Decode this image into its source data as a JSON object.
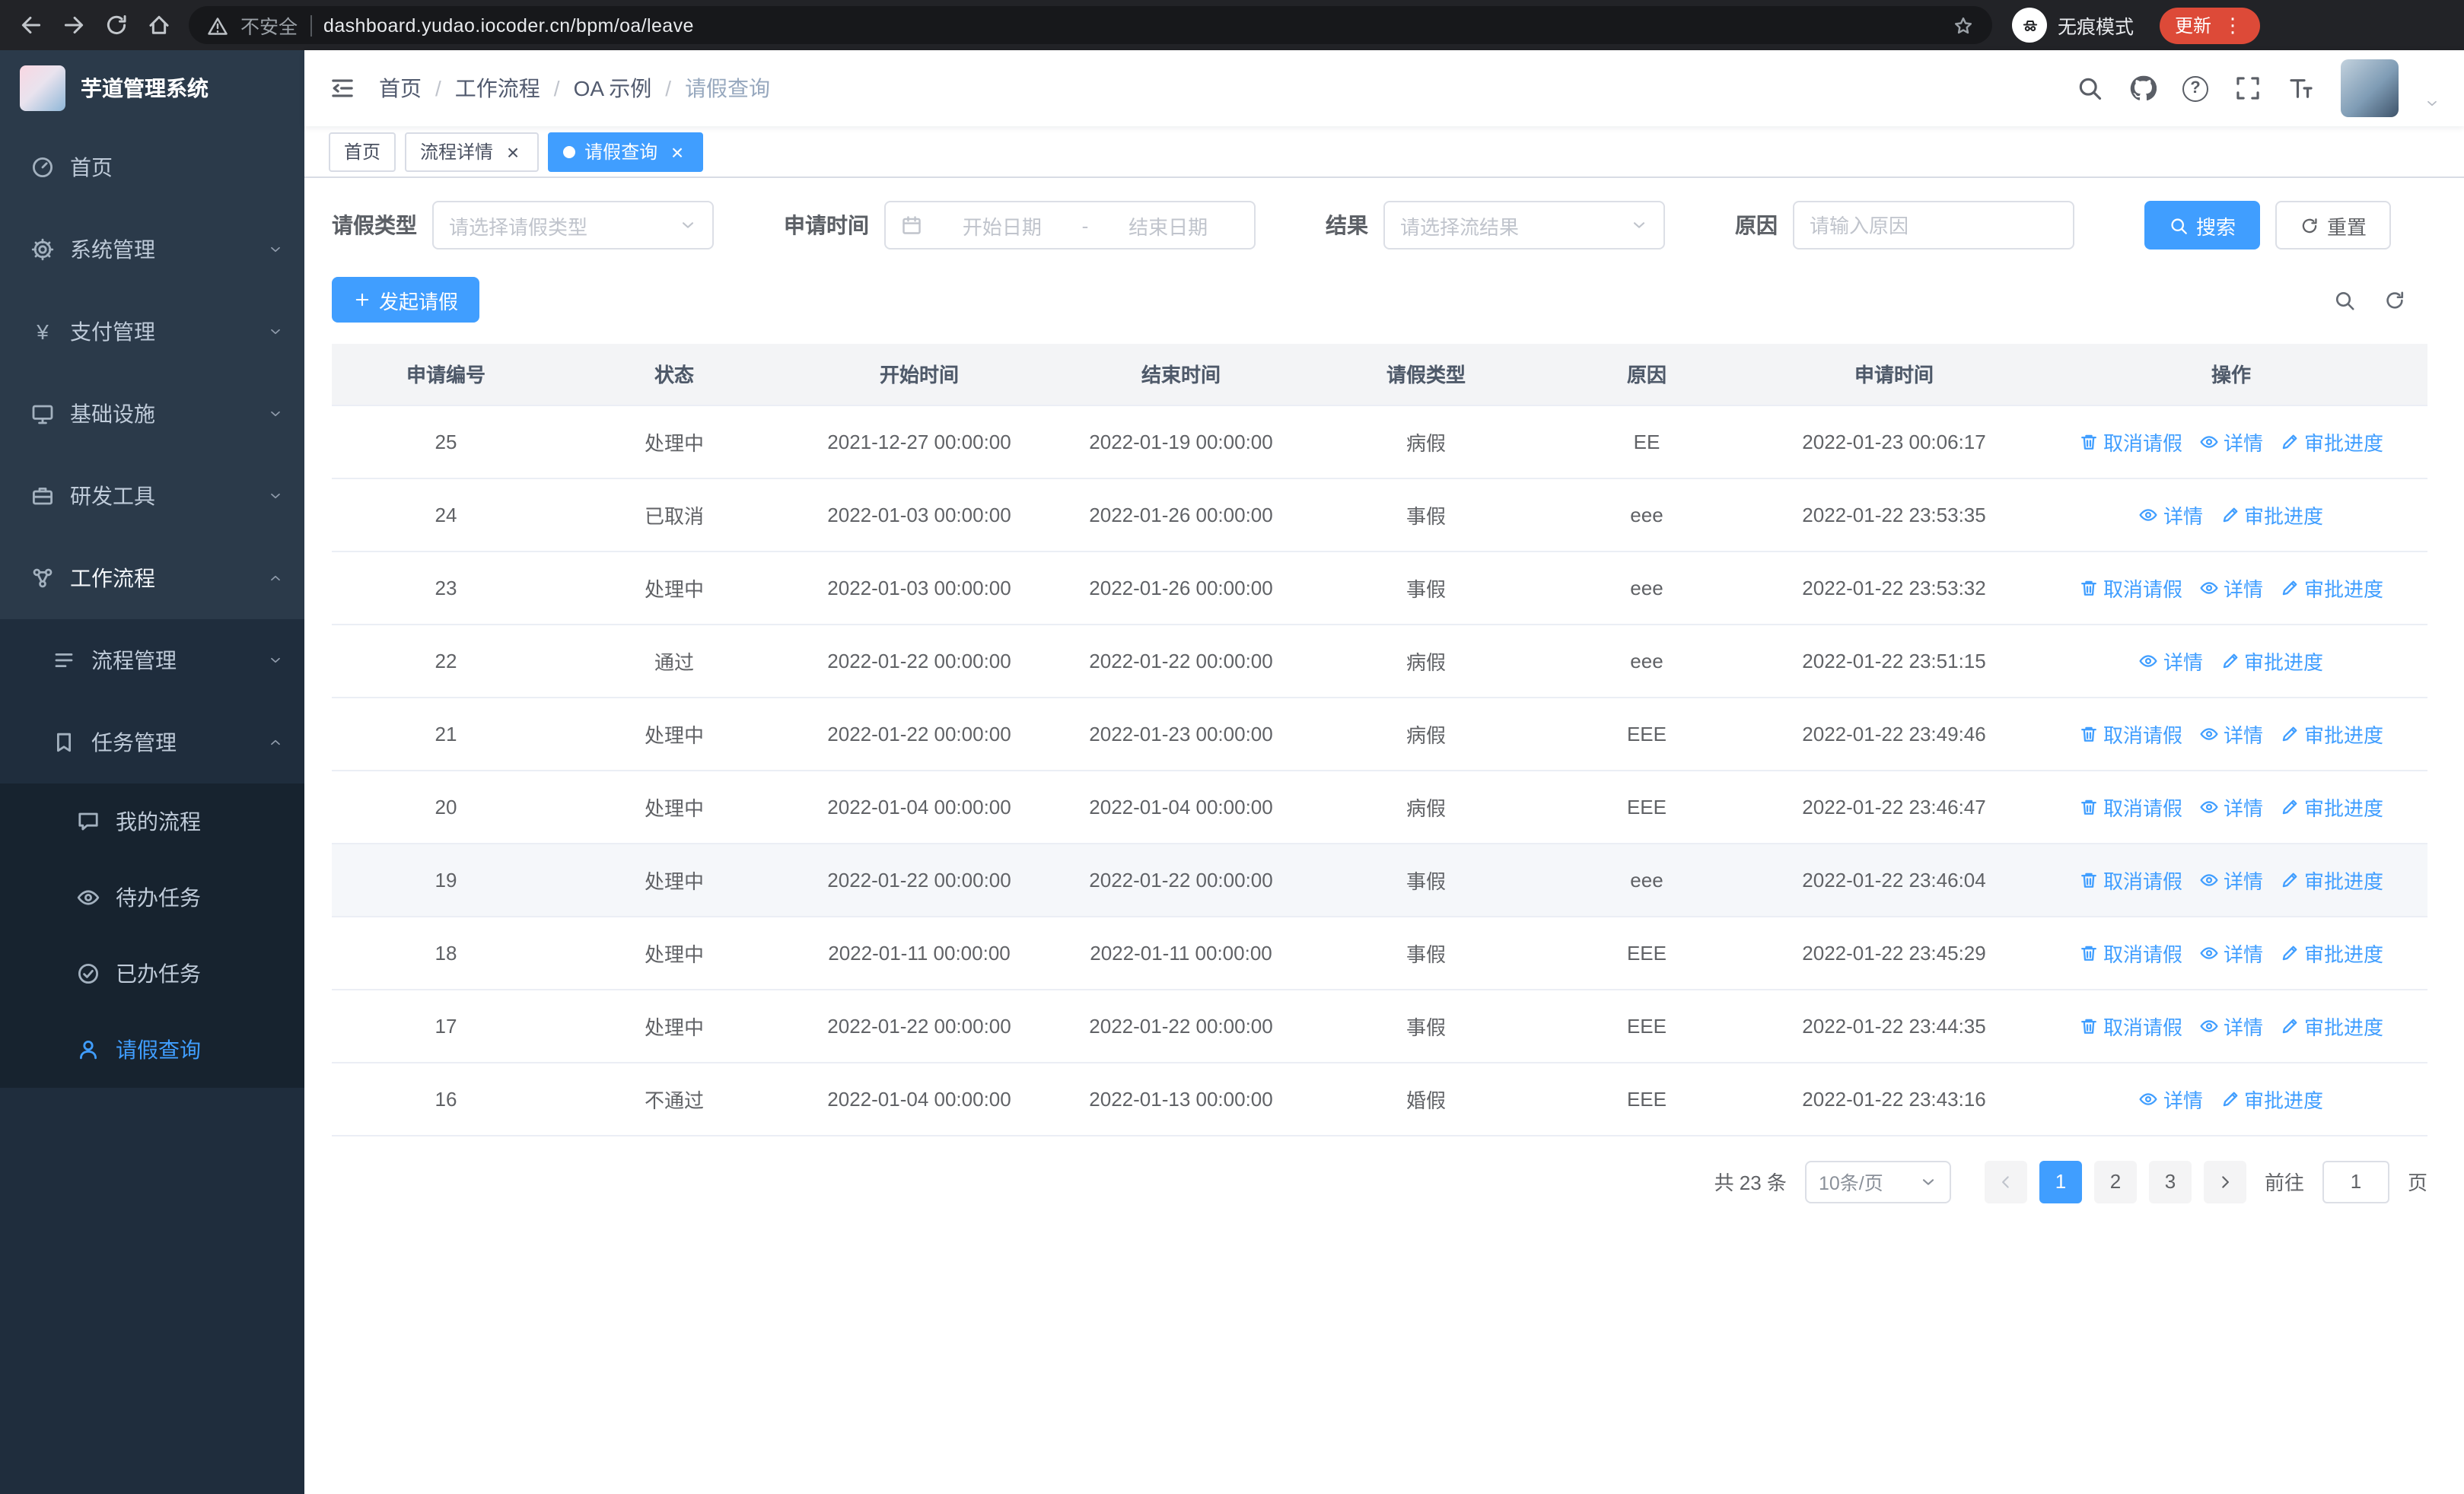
{
  "browser": {
    "security_warning": "不安全",
    "url": "dashboard.yudao.iocoder.cn/bpm/oa/leave",
    "incognito_label": "无痕模式",
    "update_label": "更新"
  },
  "sidebar": {
    "title": "芋道管理系统",
    "menu": [
      {
        "label": "首页",
        "icon": "dashboard-icon"
      },
      {
        "label": "系统管理",
        "icon": "gear-icon"
      },
      {
        "label": "支付管理",
        "icon": "yen-icon"
      },
      {
        "label": "基础设施",
        "icon": "monitor-icon"
      },
      {
        "label": "研发工具",
        "icon": "toolbox-icon"
      },
      {
        "label": "工作流程",
        "icon": "workflow-icon",
        "expanded": true,
        "children": [
          {
            "label": "流程管理",
            "icon": "process-icon"
          },
          {
            "label": "任务管理",
            "icon": "task-icon",
            "expanded": true,
            "children": [
              {
                "label": "我的流程",
                "icon": "chat-icon"
              },
              {
                "label": "待办任务",
                "icon": "eye-icon"
              },
              {
                "label": "已办任务",
                "icon": "done-icon"
              },
              {
                "label": "请假查询",
                "icon": "user-icon",
                "active": true
              }
            ]
          }
        ]
      }
    ]
  },
  "header": {
    "breadcrumb": [
      "首页",
      "工作流程",
      "OA 示例",
      "请假查询"
    ],
    "breadcrumb_separator": "/"
  },
  "tabs": [
    {
      "label": "首页",
      "closable": false,
      "active": false
    },
    {
      "label": "流程详情",
      "closable": true,
      "active": false
    },
    {
      "label": "请假查询",
      "closable": true,
      "active": true
    }
  ],
  "filters": {
    "leave_type_label": "请假类型",
    "leave_type_placeholder": "请选择请假类型",
    "apply_time_label": "申请时间",
    "start_placeholder": "开始日期",
    "range_separator": "-",
    "end_placeholder": "结束日期",
    "result_label": "结果",
    "result_placeholder": "请选择流结果",
    "reason_label": "原因",
    "reason_placeholder": "请输入原因",
    "search_label": "搜索",
    "reset_label": "重置"
  },
  "toolbar": {
    "create_label": "发起请假"
  },
  "actions": {
    "cancel": "取消请假",
    "detail": "详情",
    "progress": "审批进度"
  },
  "table": {
    "columns": [
      "申请编号",
      "状态",
      "开始时间",
      "结束时间",
      "请假类型",
      "原因",
      "申请时间",
      "操作"
    ],
    "rows": [
      {
        "id": "25",
        "status": "处理中",
        "start": "2021-12-27 00:00:00",
        "end": "2022-01-19 00:00:00",
        "type": "病假",
        "reason": "EE",
        "applied": "2022-01-23 00:06:17",
        "actions": [
          "cancel",
          "detail",
          "progress"
        ]
      },
      {
        "id": "24",
        "status": "已取消",
        "start": "2022-01-03 00:00:00",
        "end": "2022-01-26 00:00:00",
        "type": "事假",
        "reason": "eee",
        "applied": "2022-01-22 23:53:35",
        "actions": [
          "detail",
          "progress"
        ]
      },
      {
        "id": "23",
        "status": "处理中",
        "start": "2022-01-03 00:00:00",
        "end": "2022-01-26 00:00:00",
        "type": "事假",
        "reason": "eee",
        "applied": "2022-01-22 23:53:32",
        "actions": [
          "cancel",
          "detail",
          "progress"
        ]
      },
      {
        "id": "22",
        "status": "通过",
        "start": "2022-01-22 00:00:00",
        "end": "2022-01-22 00:00:00",
        "type": "病假",
        "reason": "eee",
        "applied": "2022-01-22 23:51:15",
        "actions": [
          "detail",
          "progress"
        ]
      },
      {
        "id": "21",
        "status": "处理中",
        "start": "2022-01-22 00:00:00",
        "end": "2022-01-23 00:00:00",
        "type": "病假",
        "reason": "EEE",
        "applied": "2022-01-22 23:49:46",
        "actions": [
          "cancel",
          "detail",
          "progress"
        ]
      },
      {
        "id": "20",
        "status": "处理中",
        "start": "2022-01-04 00:00:00",
        "end": "2022-01-04 00:00:00",
        "type": "病假",
        "reason": "EEE",
        "applied": "2022-01-22 23:46:47",
        "actions": [
          "cancel",
          "detail",
          "progress"
        ]
      },
      {
        "id": "19",
        "status": "处理中",
        "start": "2022-01-22 00:00:00",
        "end": "2022-01-22 00:00:00",
        "type": "事假",
        "reason": "eee",
        "applied": "2022-01-22 23:46:04",
        "actions": [
          "cancel",
          "detail",
          "progress"
        ],
        "highlighted": true
      },
      {
        "id": "18",
        "status": "处理中",
        "start": "2022-01-11 00:00:00",
        "end": "2022-01-11 00:00:00",
        "type": "事假",
        "reason": "EEE",
        "applied": "2022-01-22 23:45:29",
        "actions": [
          "cancel",
          "detail",
          "progress"
        ]
      },
      {
        "id": "17",
        "status": "处理中",
        "start": "2022-01-22 00:00:00",
        "end": "2022-01-22 00:00:00",
        "type": "事假",
        "reason": "EEE",
        "applied": "2022-01-22 23:44:35",
        "actions": [
          "cancel",
          "detail",
          "progress"
        ]
      },
      {
        "id": "16",
        "status": "不通过",
        "start": "2022-01-04 00:00:00",
        "end": "2022-01-13 00:00:00",
        "type": "婚假",
        "reason": "EEE",
        "applied": "2022-01-22 23:43:16",
        "actions": [
          "detail",
          "progress"
        ]
      }
    ]
  },
  "pagination": {
    "total_text": "共 23 条",
    "page_size_text": "10条/页",
    "pages": [
      "1",
      "2",
      "3"
    ],
    "active_page": "1",
    "goto_prefix": "前往",
    "goto_value": "1",
    "goto_suffix": "页"
  },
  "colors": {
    "accent": "#409eff",
    "sidebar_bg": "#1f2d3d",
    "browser_bar": "#222327"
  }
}
